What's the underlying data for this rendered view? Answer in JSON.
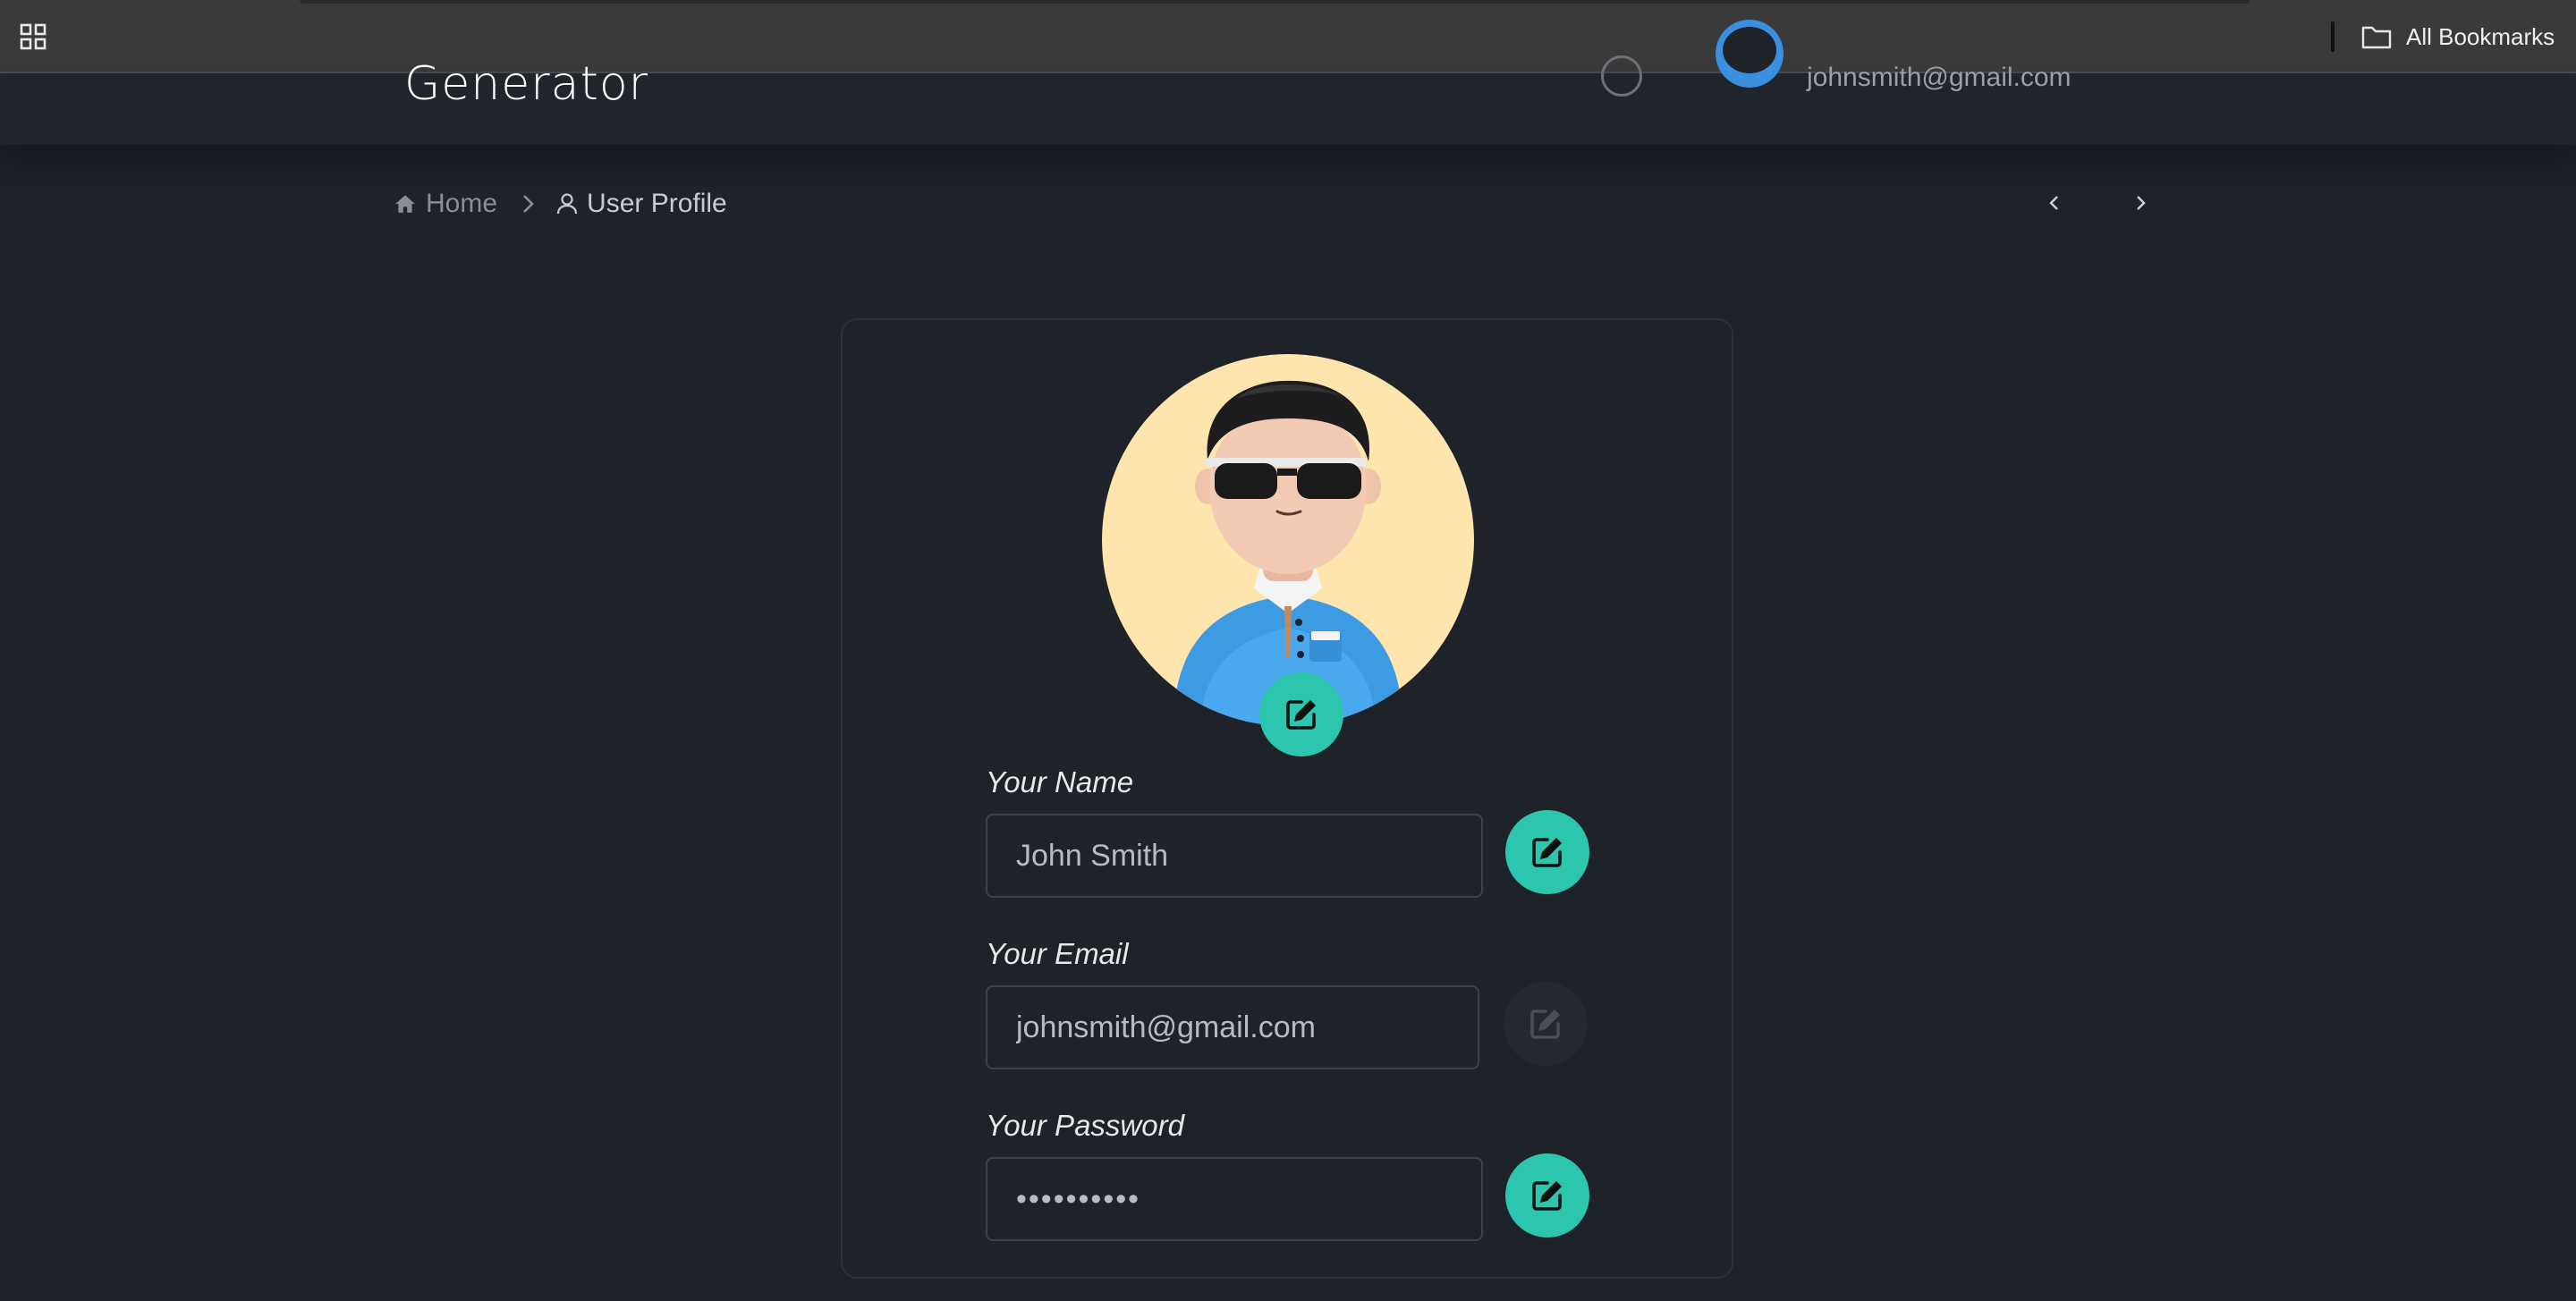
{
  "browser": {
    "bookmarks_label": "All Bookmarks"
  },
  "header": {
    "logo_text": "Generator",
    "user_email": "johnsmith@gmail.com"
  },
  "breadcrumb": {
    "home": "Home",
    "current": "User Profile"
  },
  "profile": {
    "name_label": "Your Name",
    "name_value": "John Smith",
    "email_label": "Your Email",
    "email_value": "johnsmith@gmail.com",
    "password_label": "Your Password",
    "password_value": "••••••••••",
    "email_edit_disabled": true
  },
  "colors": {
    "background": "#1e2229",
    "accent": "#2cc5ad",
    "avatar_bg": "#fde5ad",
    "input_border": "#3d424a"
  },
  "icons": {
    "apps": "apps-grid-icon",
    "folder": "folder-icon",
    "home": "home-icon",
    "user": "user-icon",
    "chevron_right": "chevron-right-icon",
    "chevron_left": "chevron-left-icon",
    "edit": "edit-pencil-icon"
  }
}
